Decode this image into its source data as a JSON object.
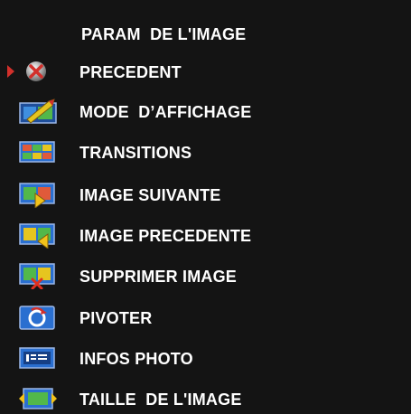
{
  "menu": {
    "title": "PARAM  DE L'IMAGE",
    "selected_index": 0,
    "items": [
      {
        "label": "PRECEDENT",
        "icon": "back-icon"
      },
      {
        "label": "MODE  D’AFFICHAGE",
        "icon": "display-mode-icon"
      },
      {
        "label": "TRANSITIONS",
        "icon": "transitions-icon"
      },
      {
        "label": "IMAGE SUIVANTE",
        "icon": "next-image-icon"
      },
      {
        "label": "IMAGE PRECEDENTE",
        "icon": "previous-image-icon"
      },
      {
        "label": "SUPPRIMER IMAGE",
        "icon": "delete-image-icon"
      },
      {
        "label": "PIVOTER",
        "icon": "rotate-icon"
      },
      {
        "label": "INFOS PHOTO",
        "icon": "photo-info-icon"
      },
      {
        "label": "TAILLE  DE L'IMAGE",
        "icon": "image-size-icon"
      }
    ]
  },
  "colors": {
    "background": "#141414",
    "text": "#ffffff",
    "cursor": "#d2302b"
  }
}
